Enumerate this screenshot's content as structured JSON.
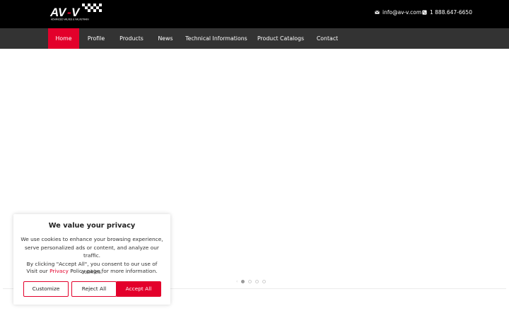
{
  "brand": {
    "logo_text": "AV-V",
    "logo_tagline": "ADVANCED VALVES & VALVETRAIN",
    "accent": "#e3002b"
  },
  "header": {
    "email": "info@av-v.com",
    "phone": "1 888.647-6650"
  },
  "nav": {
    "items": [
      {
        "label": "Home",
        "active": true
      },
      {
        "label": "Profile"
      },
      {
        "label": "Products"
      },
      {
        "label": "News"
      },
      {
        "label": "Technical Informations"
      },
      {
        "label": "Product Catalogs"
      },
      {
        "label": "Contact"
      }
    ]
  },
  "slider": {
    "slide_count": 4,
    "active_slide": 1
  },
  "cookie": {
    "title": "We value your privacy",
    "body_line1": "We use cookies to enhance your browsing experience,",
    "body_line2": "serve personalized ads or content, and analyze our traffic.",
    "body_line3": "By clicking \"Accept All\", you consent to our use of cookies.",
    "visit_prefix": "Visit our ",
    "visit_link": "Privacy",
    "visit_suffix": " Policy page for more information.",
    "customize_label": "Customize",
    "reject_label": "Reject All",
    "accept_label": "Accept All"
  }
}
